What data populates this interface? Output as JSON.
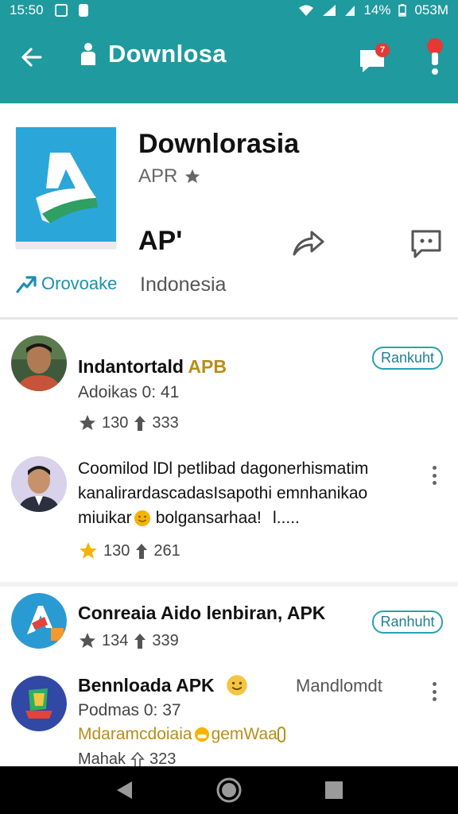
{
  "status_bar": {
    "time": "15:50",
    "battery": "14%",
    "clock_right": "053M"
  },
  "app_bar": {
    "title": "Downlosa",
    "chat_badge": "7"
  },
  "app": {
    "name": "Downlorasia",
    "subtitle": "APR",
    "size_label": "AP'",
    "promo_link": "Orovoake",
    "country": "Indonesia"
  },
  "feed": [
    {
      "title": "Indantortald ",
      "title_accent": "APB",
      "meta": "Adoikas 0: 41",
      "stars": "130",
      "downloads": "333",
      "action": "Rankuht"
    },
    {
      "body_line1": "Coomilod lDl petlibad dagonerhismatim",
      "body_line2": "kanalirardascadasIsapothi emnhanikao",
      "body_line3_a": "miuikar ",
      "body_line3_b": " bolgansarhaa!   l.....",
      "stars": "130",
      "downloads": "261"
    },
    {
      "title": "Conreaia Aido lenbiran, APK",
      "stars": "134",
      "downloads": "339",
      "action": "Ranhuht"
    },
    {
      "title": "Bennloada APK",
      "tag": "Mandlomdt",
      "meta": "Podmas 0: 37",
      "promo_a": "Mdaramcdoiaia ",
      "promo_b": "gemWaa ",
      "stats_label": "Mahak",
      "downloads": "323"
    }
  ],
  "colors": {
    "primary": "#1f9a9e",
    "accent": "#2aa0b4",
    "gold": "#b98d18",
    "star": "#f4b400"
  }
}
